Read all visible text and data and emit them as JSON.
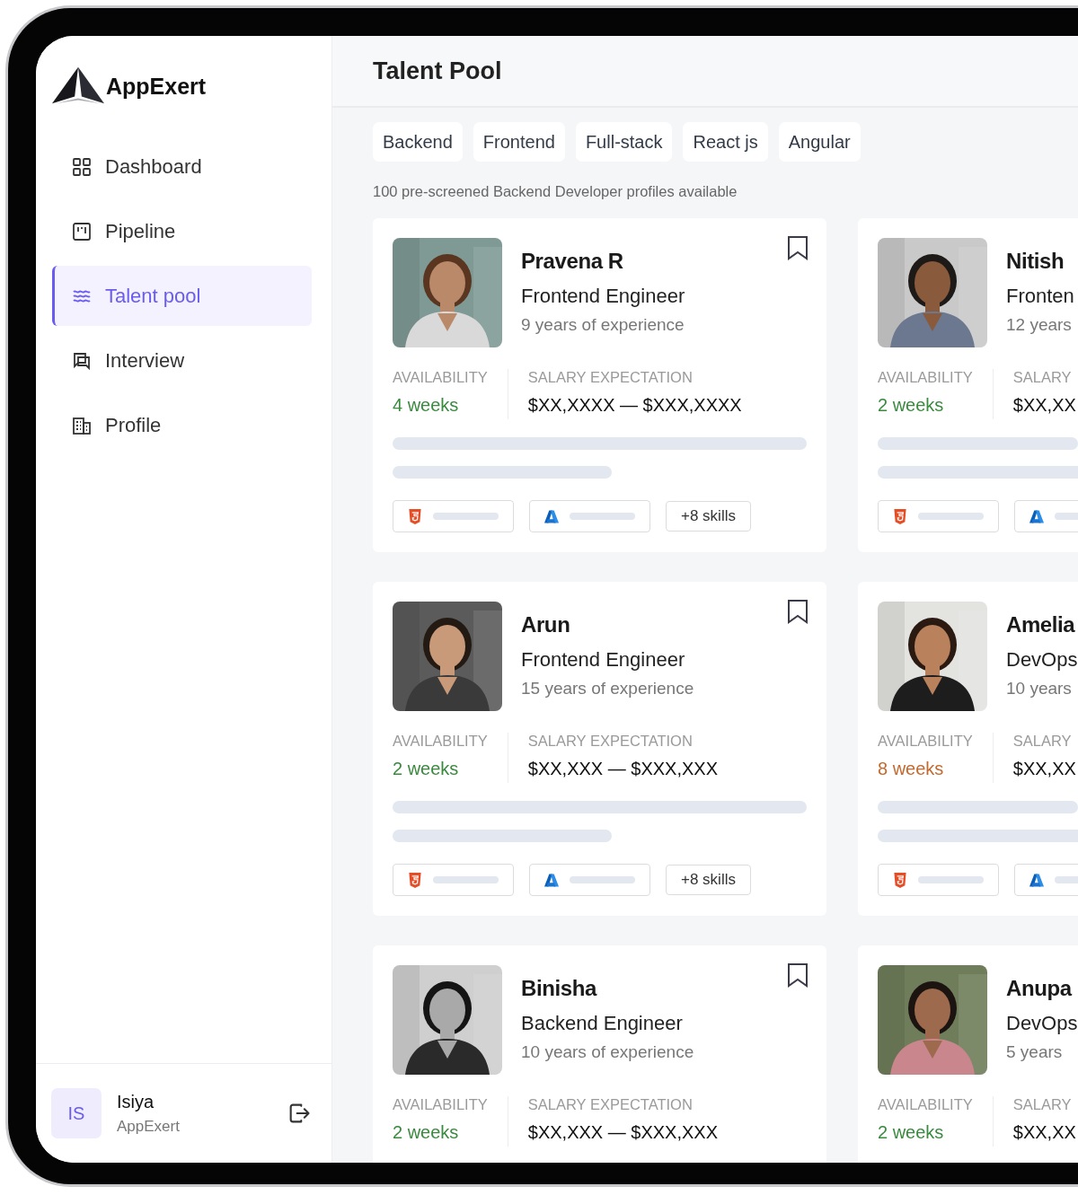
{
  "brand": "AppExert",
  "nav": [
    {
      "label": "Dashboard",
      "selected": false
    },
    {
      "label": "Pipeline",
      "selected": false
    },
    {
      "label": "Talent pool",
      "selected": true
    },
    {
      "label": "Interview",
      "selected": false
    },
    {
      "label": "Profile",
      "selected": false
    }
  ],
  "user": {
    "initials": "IS",
    "name": "Isiya",
    "org": "AppExert"
  },
  "page_title": "Talent Pool",
  "filters": [
    "Backend",
    "Frontend",
    "Full-stack",
    "React js",
    "Angular"
  ],
  "summary": "100 pre-screened Backend Developer profiles available",
  "candidates": [
    {
      "name": "Pravena R",
      "role": "Frontend Engineer",
      "experience": "9 years of experience",
      "availability_label": "AVAILABILITY",
      "availability": {
        "text": "4 weeks",
        "color": "#3a8a3f"
      },
      "salary_label": "SALARY EXPECTATION",
      "salary": "$XX,XXXX — $XXX,XXXX",
      "skills": [
        {
          "kind": "html"
        },
        {
          "kind": "azure"
        }
      ],
      "skills_more": "+8 skills"
    },
    {
      "name": "Nitish",
      "role": "Fronten",
      "experience": "12 years",
      "availability_label": "AVAILABILITY",
      "availability": {
        "text": "2 weeks",
        "color": "#3a8a3f"
      },
      "salary_label": "SALARY",
      "salary": "$XX,XX",
      "skills": [
        {
          "kind": "html"
        },
        {
          "kind": "azure"
        }
      ]
    },
    {
      "name": "Arun",
      "role": "Frontend Engineer",
      "experience": "15 years of experience",
      "availability_label": "AVAILABILITY",
      "availability": {
        "text": "2 weeks",
        "color": "#3a8a3f"
      },
      "salary_label": "SALARY EXPECTATION",
      "salary": "$XX,XXX — $XXX,XXX",
      "skills": [
        {
          "kind": "html"
        },
        {
          "kind": "azure"
        }
      ],
      "skills_more": "+8 skills"
    },
    {
      "name": "Amelia",
      "role": "DevOps",
      "experience": "10 years",
      "availability_label": "AVAILABILITY",
      "availability": {
        "text": "8 weeks",
        "color": "#c4692f"
      },
      "salary_label": "SALARY",
      "salary": "$XX,XX",
      "skills": [
        {
          "kind": "html"
        },
        {
          "kind": "azure"
        }
      ]
    },
    {
      "name": "Binisha",
      "role": "Backend Engineer",
      "experience": "10 years of experience",
      "availability_label": "AVAILABILITY",
      "availability": {
        "text": "2 weeks",
        "color": "#3a8a3f"
      },
      "salary_label": "SALARY EXPECTATION",
      "salary": "$XX,XXX — $XXX,XXX"
    },
    {
      "name": "Anupa",
      "role": "DevOps",
      "experience": "5 years",
      "availability_label": "AVAILABILITY",
      "availability": {
        "text": "2 weeks",
        "color": "#3a8a3f"
      },
      "salary_label": "SALARY",
      "salary": "$XX,XX"
    }
  ]
}
